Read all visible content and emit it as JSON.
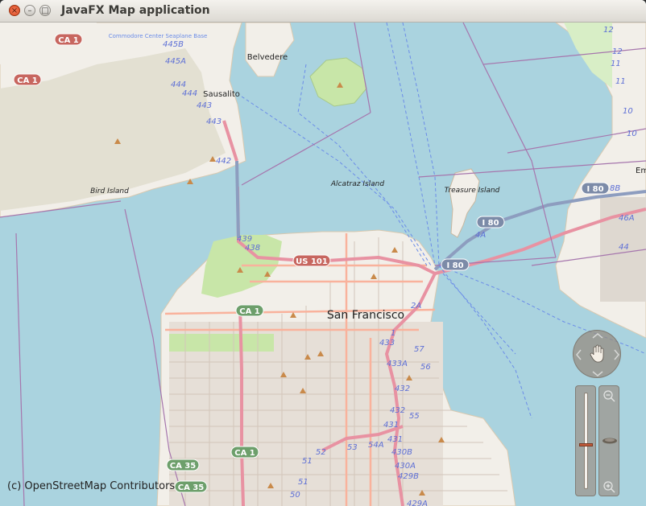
{
  "window": {
    "title": "JavaFX Map application",
    "close_glyph": "×",
    "minimize_glyph": "–",
    "maximize_glyph": "□"
  },
  "map": {
    "attribution": "(c) OpenStreetMap Contributors",
    "places": {
      "san_francisco": "San Francisco",
      "sausalito": "Sausalito",
      "belvedere": "Belvedere",
      "alcatraz": "Alcatraz Island",
      "treasure": "Treasure Island",
      "bird": "Bird Island",
      "commodore": "Commodore Center Seaplane Base",
      "em": "Em"
    },
    "shields": {
      "ca1_a": "CA 1",
      "ca1_b": "CA 1",
      "ca1_c": "CA 1",
      "ca1_d": "CA 1",
      "us101": "US 101",
      "i80_a": "I 80",
      "i80_b": "I 80",
      "i80_c": "I 80",
      "ca35_a": "CA 35",
      "ca35_b": "CA 35"
    },
    "exits": {
      "e445b": "445B",
      "e445a": "445A",
      "e444a": "444",
      "e444b": "444",
      "e443a": "443",
      "e443b": "443",
      "e442": "442",
      "e439": "439",
      "e438": "438",
      "e2a": "2A",
      "e1": "1",
      "e433": "433",
      "e433a": "433A",
      "e57": "57",
      "e56": "56",
      "e432": "432",
      "e432b": "432",
      "e431": "431",
      "e431b": "431",
      "e55": "55",
      "e54a": "54A",
      "e53": "53",
      "e52": "52",
      "e51a": "51",
      "e51b": "51",
      "e50": "50",
      "e430b": "430B",
      "e430a": "430A",
      "e429b": "429B",
      "e429a": "429A",
      "e12a": "12",
      "e12b": "12",
      "e11a": "11",
      "e11b": "11",
      "e10a": "10",
      "e10b": "10",
      "e8b": "8B",
      "e46a": "46A",
      "e44": "44",
      "e4a": "4A"
    }
  },
  "controls": {
    "pan_icon": "hand-icon",
    "zoom_in_icon": "zoom-in-icon",
    "zoom_out_icon": "zoom-out-icon",
    "zoom_level": 0.5
  },
  "colors": {
    "water": "#aad3df",
    "land": "#f2efe9",
    "park": "#c8e6a8",
    "motorway": "#e892a2",
    "trunk": "#f9b29c",
    "bridge": "#8d9dbf",
    "boundary": "#a676ad"
  }
}
